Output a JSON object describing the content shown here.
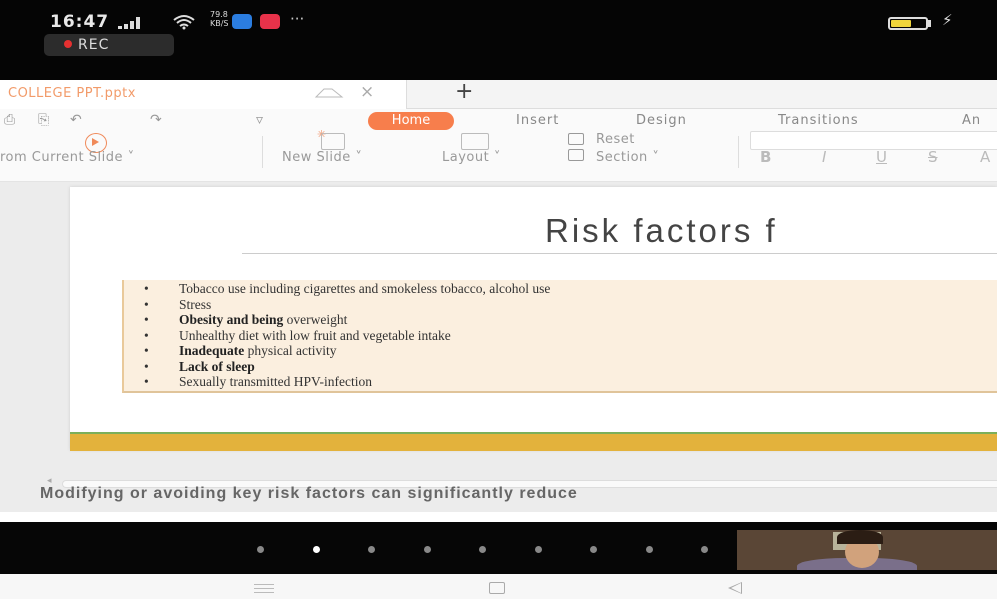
{
  "status_bar": {
    "time": "16:47",
    "net_speed": "79.8\nKB/S",
    "more_dots": "···",
    "recording_label": "REC",
    "battery_level": 0.6,
    "charging_icon": "⚡"
  },
  "tab_bar": {
    "document_name": "COLLEGE PPT.pptx",
    "close_symbol": "×",
    "new_tab_symbol": "+"
  },
  "ribbon": {
    "quick_access": [
      "⎙",
      "⎘",
      "↶",
      "↷",
      "▿"
    ],
    "menu_tabs": [
      "Home",
      "Insert",
      "Design",
      "Transitions",
      "An"
    ],
    "active_tab": "Home",
    "from_current_slide": "rom Current Slide ˅",
    "new_slide": "New Slide ˅",
    "layout": "Layout ˅",
    "reset": "Reset",
    "section": "Section ˅",
    "format_buttons": [
      "B",
      "I",
      "U",
      "S",
      "A"
    ]
  },
  "slide": {
    "title": "Risk factors f",
    "bullets": [
      {
        "bold": "",
        "text": "Tobacco use including cigarettes and smokeless tobacco, alcohol use"
      },
      {
        "bold": "",
        "text": "Stress"
      },
      {
        "bold": "Obesity and being",
        "text": " overweight"
      },
      {
        "bold": "",
        "text": "Unhealthy diet with low fruit and vegetable intake"
      },
      {
        "bold": "Inadequate",
        "text": " physical activity"
      },
      {
        "bold": "Lack of sleep",
        "text": ""
      },
      {
        "bold": "",
        "text": "Sexually transmitted HPV-infection"
      }
    ],
    "bullet_symbol": "•",
    "colors": {
      "accent_bar": "#e3b23c",
      "bullet_bg": "#fbefdf",
      "line": "#7caf5a"
    }
  },
  "notes": {
    "text": "Modifying or avoiding key risk factors can significantly reduce"
  },
  "media_strip": {
    "page_count": 9,
    "active_page": 2
  },
  "icons": {
    "signal": "signal-icon",
    "wifi": "wifi-icon",
    "play": "play-from-slide-icon",
    "new_slide": "new-slide-icon",
    "layout": "layout-icon",
    "reset": "reset-icon",
    "section": "section-icon"
  }
}
